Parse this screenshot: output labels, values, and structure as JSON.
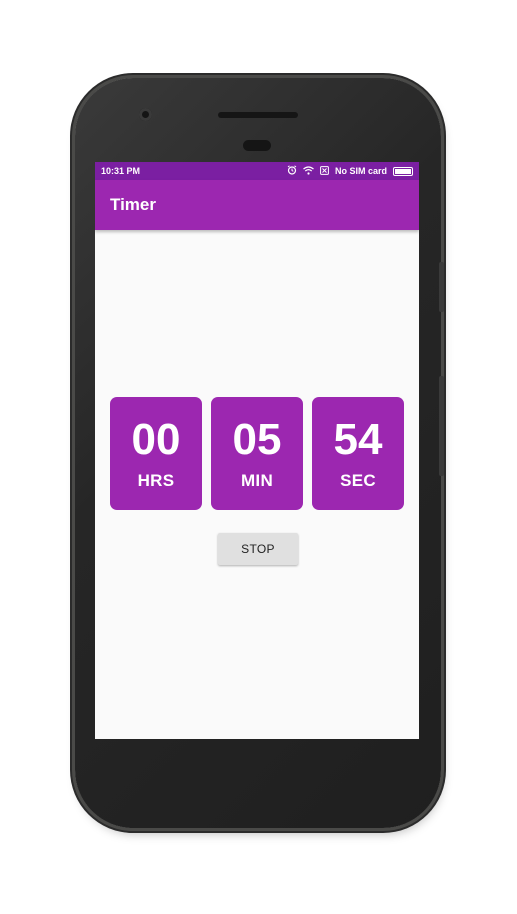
{
  "status_bar": {
    "time": "10:31 PM",
    "sim_status": "No SIM card",
    "icons": [
      "alarm-icon",
      "wifi-icon",
      "no-sim-icon",
      "battery-icon"
    ]
  },
  "toolbar": {
    "title": "Timer"
  },
  "timer": {
    "hours": {
      "value": "00",
      "label": "HRS"
    },
    "minutes": {
      "value": "05",
      "label": "MIN"
    },
    "seconds": {
      "value": "54",
      "label": "SEC"
    }
  },
  "stop_button": {
    "label": "STOP"
  },
  "colors": {
    "primary": "#9c27b0",
    "primary_dark": "#7b1fa2",
    "button_bg": "#e0e0e0",
    "screen_bg": "#fafafa"
  }
}
